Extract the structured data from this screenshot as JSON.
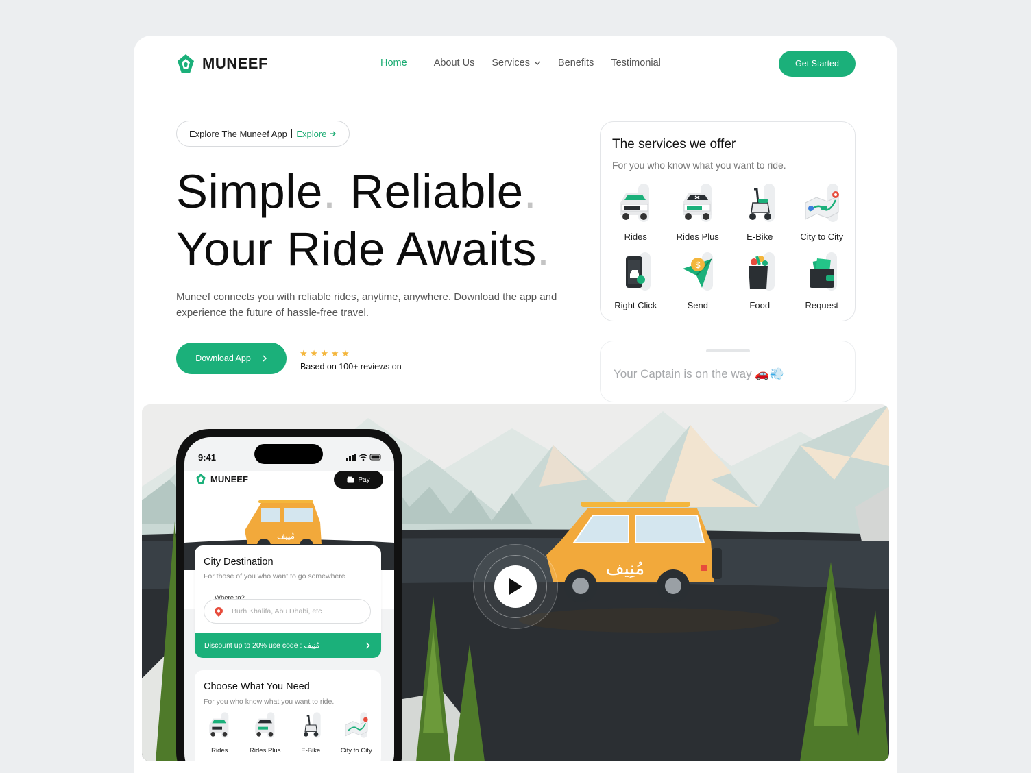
{
  "brand": {
    "name": "MUNEEF",
    "accent": "#1bb07a"
  },
  "nav": {
    "items": [
      {
        "label": "Home",
        "active": true
      },
      {
        "label": "About Us"
      },
      {
        "label": "Services",
        "has_dropdown": true
      },
      {
        "label": "Benefits"
      },
      {
        "label": "Testimonial"
      }
    ],
    "cta": "Get Started"
  },
  "hero": {
    "pill_text": "Explore The Muneef App",
    "pill_link": "Explore",
    "headline_line1_a": "Simple",
    "headline_line1_b": "Reliable",
    "headline_line2": "Your Ride Awaits",
    "dot": ".",
    "description": "Muneef connects you with reliable rides, anytime, anywhere. Download the app and experience the future of hassle-free travel.",
    "download_label": "Download App",
    "stars": "★ ★ ★ ★ ★",
    "reviews": "Based on 100+ reviews on"
  },
  "services_card": {
    "title": "The services we offer",
    "subtitle": "For you who know what you want to ride.",
    "items": [
      {
        "label": "Rides",
        "icon": "car-icon"
      },
      {
        "label": "Rides Plus",
        "icon": "premium-car-icon"
      },
      {
        "label": "E-Bike",
        "icon": "scooter-icon"
      },
      {
        "label": "City to City",
        "icon": "map-route-icon"
      },
      {
        "label": "Right Click",
        "icon": "phone-car-icon"
      },
      {
        "label": "Send",
        "icon": "send-money-icon"
      },
      {
        "label": "Food",
        "icon": "food-bag-icon"
      },
      {
        "label": "Request",
        "icon": "wallet-icon"
      }
    ]
  },
  "captain_card": {
    "text": "Your Captain is on the way 🚗💨"
  },
  "phone": {
    "time": "9:41",
    "brand": "MUNEEF",
    "pay_label": "Pay",
    "car_text": "مُنِيف",
    "card_title": "City Destination",
    "card_subtitle": "For those of you who want to go somewhere",
    "where_label": "Where to?",
    "where_placeholder": "Burh Khalifa, Abu Dhabi, etc",
    "discount": "Discount up to 20% use code : مُنِيف",
    "card2_title": "Choose What You Need",
    "card2_subtitle": "For you who know what you want to ride.",
    "mini_items": [
      "Rides",
      "Rides Plus",
      "E-Bike",
      "City to City"
    ]
  },
  "scene": {
    "car_text": "مُنِيف"
  }
}
